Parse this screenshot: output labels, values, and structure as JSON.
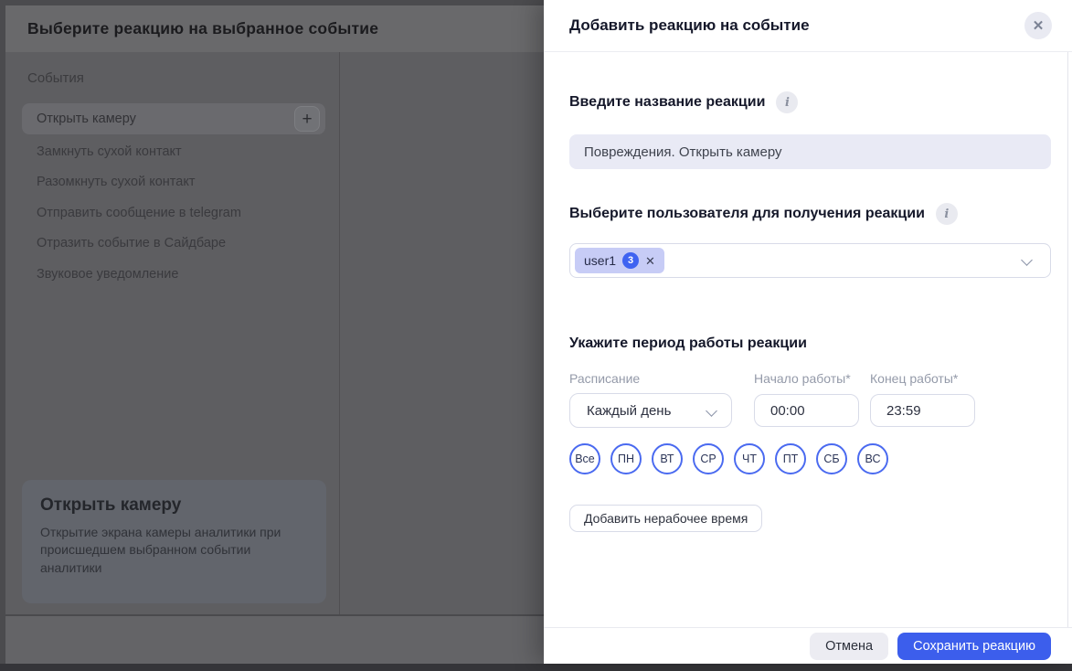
{
  "backdrop": {
    "title": "Выберите реакцию на выбранное событие",
    "section_label": "События",
    "selected_event": "Открыть камеру",
    "plus_label": "+",
    "events": [
      "Открыть камеру",
      "Замкнуть сухой контакт",
      "Разомкнуть сухой контакт",
      "Отправить сообщение в telegram",
      "Отразить событие в Сайдбаре",
      "Звуковое уведомление"
    ],
    "info_card": {
      "title": "Открыть камеру",
      "description": "Открытие экрана камеры аналитики при происшедшем выбранном событии аналитики"
    }
  },
  "modal": {
    "title": "Добавить реакцию на событие",
    "close_icon": "✕",
    "info_icon": "i",
    "name_section": {
      "heading": "Введите название реакции",
      "value": "Повреждения. Открыть камеру"
    },
    "user_section": {
      "heading": "Выберите пользователя для получения реакции",
      "chip_label": "user1",
      "chip_count": "3",
      "chip_remove_icon": "✕"
    },
    "period_section": {
      "heading": "Укажите период работы реакции",
      "schedule_label": "Расписание",
      "schedule_value": "Каждый день",
      "start_label": "Начало работы*",
      "start_value": "00:00",
      "end_label": "Конец работы*",
      "end_value": "23:59",
      "days": [
        "Все",
        "ПН",
        "ВТ",
        "СР",
        "ЧТ",
        "ПТ",
        "СБ",
        "ВС"
      ],
      "add_downtime_label": "Добавить нерабочее время"
    },
    "footer": {
      "cancel_label": "Отмена",
      "save_label": "Сохранить реакцию"
    }
  },
  "colors": {
    "accent": "#3c5eec",
    "day_outline": "#4a6af0",
    "chip_bg": "#c7ccf6",
    "badge_bg": "#3f63f1",
    "overlay": "#5e5e61"
  }
}
